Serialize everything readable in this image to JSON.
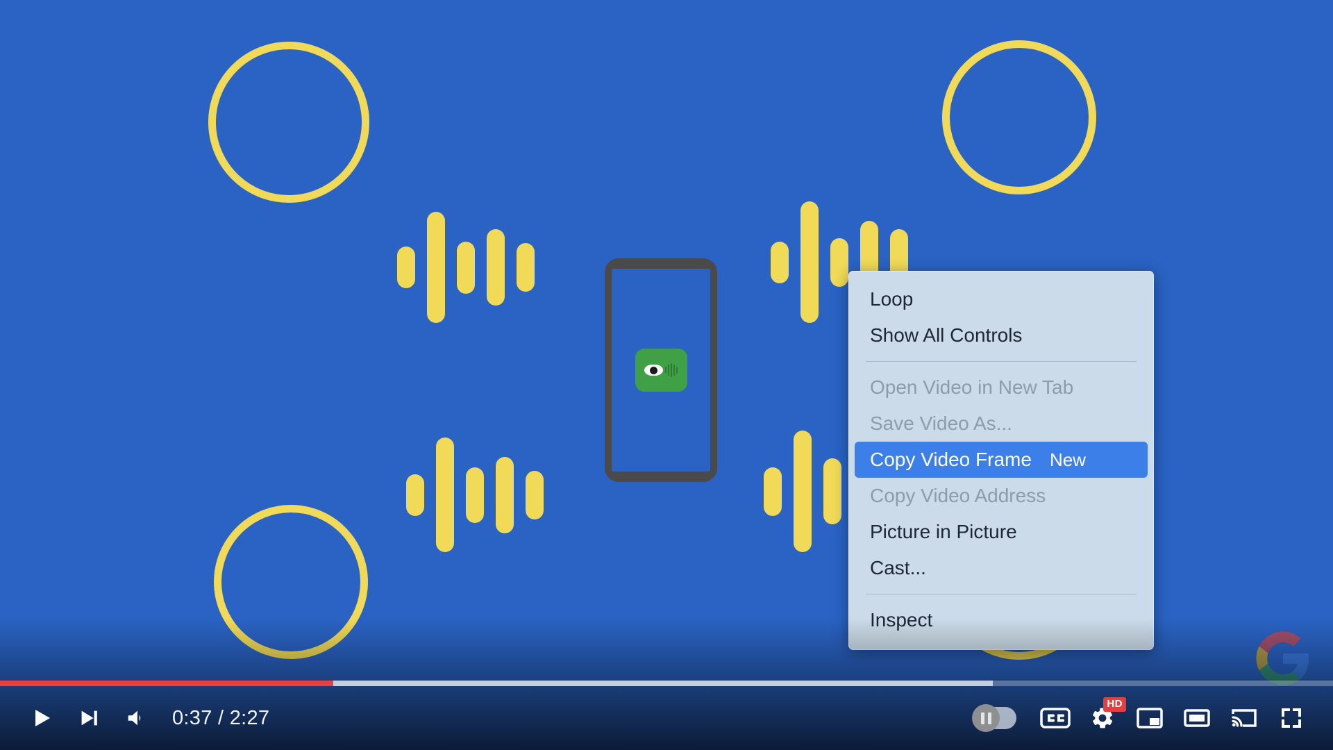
{
  "player": {
    "time_display": "0:37 / 2:27",
    "current_time": "0:37",
    "duration": "2:27",
    "progress_played_percent": 25,
    "progress_buffered_percent": 74.5,
    "progress_color": "#e8403a",
    "controls": {
      "play": "Play",
      "next": "Next",
      "volume": "Mute",
      "autoplay": "Autoplay is off",
      "captions": "Subtitles/closed captions (c)",
      "settings": "Settings",
      "quality_badge": "HD",
      "miniplayer": "Miniplayer (i)",
      "theater": "Theater mode (t)",
      "cast": "Play on TV",
      "fullscreen": "Full screen (f)"
    }
  },
  "context_menu": {
    "items": [
      {
        "label": "Loop",
        "state": "enabled",
        "badge": ""
      },
      {
        "label": "Show All Controls",
        "state": "enabled",
        "badge": ""
      },
      {
        "label": "Open Video in New Tab",
        "state": "disabled",
        "badge": ""
      },
      {
        "label": "Save Video As...",
        "state": "disabled",
        "badge": ""
      },
      {
        "label": "Copy Video Frame",
        "state": "selected",
        "badge": "New"
      },
      {
        "label": "Copy Video Address",
        "state": "disabled",
        "badge": ""
      },
      {
        "label": "Picture in Picture",
        "state": "enabled",
        "badge": ""
      },
      {
        "label": "Cast...",
        "state": "enabled",
        "badge": ""
      },
      {
        "label": "Inspect",
        "state": "enabled",
        "badge": ""
      }
    ],
    "highlight_color": "#3c7fe8",
    "background_color": "#cbdbe9"
  },
  "artwork": {
    "background_color": "#2a63c4",
    "accent_color": "#f0da57",
    "app_icon_color": "#3fa045",
    "bar_groups": {
      "g1": [
        60,
        160,
        75,
        110,
        70
      ],
      "g2": [
        60,
        175,
        70,
        120,
        95
      ],
      "g3": [
        60,
        165,
        80,
        110,
        70
      ],
      "g4": [
        70,
        175,
        95,
        110
      ],
      "label": "sound-wave-bars"
    },
    "phone_label": "smartphone-illustration",
    "app_icon_label": "eye-app-icon",
    "rings_label": "yellow-ring"
  },
  "watermark": {
    "label": "Google logo"
  }
}
